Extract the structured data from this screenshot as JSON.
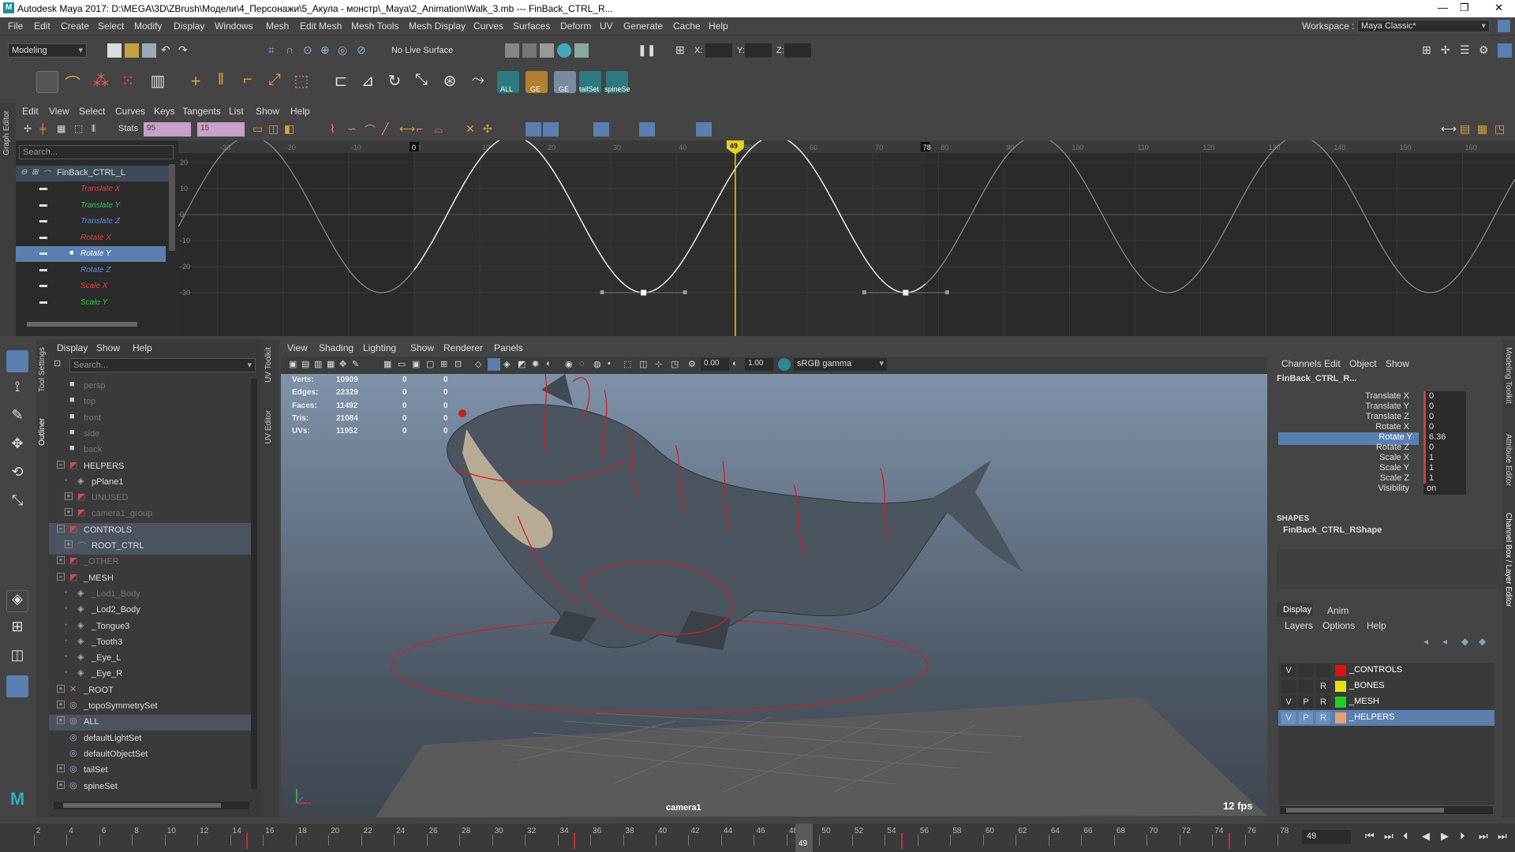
{
  "title": "Autodesk Maya 2017: D:\\MEGA\\3D\\ZBrush\\Модели\\4_Персонажи\\5_Акула - монстр\\_Maya\\2_Animation\\Walk_3.mb  ---  FinBack_CTRL_R...",
  "menubar": [
    "File",
    "Edit",
    "Create",
    "Select",
    "Modify",
    "Display",
    "Windows",
    "Mesh",
    "Edit Mesh",
    "Mesh Tools",
    "Mesh Display",
    "Curves",
    "Surfaces",
    "Deform",
    "UV",
    "Generate",
    "Cache",
    "Help"
  ],
  "workspace_label": "Workspace :",
  "workspace_value": "Maya Classic*",
  "mode_select": "Modeling",
  "live_surface": "No Live Surface",
  "coord_labels": {
    "x": "X:",
    "y": "Y:",
    "z": "Z:"
  },
  "shelf_labels": [
    "ALL",
    "GE",
    "GE",
    "tailSet",
    "spineSe"
  ],
  "graph_editor": {
    "tab": "Graph Editor",
    "menu": [
      "Edit",
      "View",
      "Select",
      "Curves",
      "Keys",
      "Tangents",
      "List",
      "Show",
      "Help"
    ],
    "stats_label": "Stats",
    "stats_values": [
      "95",
      "15"
    ],
    "search_placeholder": "Search...",
    "node": "FinBack_CTRL_L",
    "channels": [
      {
        "name": "Translate X",
        "color": "#e04040"
      },
      {
        "name": "Translate Y",
        "color": "#3cc040"
      },
      {
        "name": "Translate Z",
        "color": "#5a8ae0"
      },
      {
        "name": "Rotate X",
        "color": "#e04040"
      },
      {
        "name": "Rotate Y",
        "color": "#ffffff",
        "selected": true
      },
      {
        "name": "Rotate Z",
        "color": "#5a8ae0"
      },
      {
        "name": "Scale X",
        "color": "#e04040"
      },
      {
        "name": "Scale Y",
        "color": "#3cc040"
      }
    ],
    "x_ticks": [
      "-30",
      "-20",
      "-10",
      "0",
      "10",
      "20",
      "30",
      "40",
      "50",
      "60",
      "70",
      "80",
      "90",
      "100",
      "110",
      "120",
      "130",
      "140",
      "150",
      "160"
    ],
    "y_ticks": [
      "20",
      "10",
      "0",
      "-10",
      "-20",
      "-30"
    ],
    "range_start": "0",
    "range_end": "78",
    "current_frame": "49",
    "curve_data": {
      "type": "line",
      "period_frames": 40,
      "amplitude": 30,
      "frame_range": [
        -36,
        168
      ],
      "keys": [
        {
          "frame": 15,
          "value": 30
        },
        {
          "frame": 35,
          "value": -30
        },
        {
          "frame": 55,
          "value": 30
        },
        {
          "frame": 75,
          "value": -30
        },
        {
          "frame": 95,
          "value": 30
        }
      ]
    }
  },
  "left_tabs": [
    "Tool Settings",
    "Outliner"
  ],
  "outliner": {
    "menu": [
      "Display",
      "Show",
      "Help"
    ],
    "search_placeholder": "Search...",
    "items": [
      {
        "label": "persp",
        "indent": 0,
        "dim": true,
        "type": "camera"
      },
      {
        "label": "top",
        "indent": 0,
        "dim": true,
        "type": "camera"
      },
      {
        "label": "front",
        "indent": 0,
        "dim": true,
        "type": "camera"
      },
      {
        "label": "side",
        "indent": 0,
        "dim": true,
        "type": "camera"
      },
      {
        "label": "back",
        "indent": 0,
        "dim": true,
        "type": "camera"
      },
      {
        "label": "HELPERS",
        "indent": 0,
        "dim": false,
        "type": "group",
        "expander": "−"
      },
      {
        "label": "pPlane1",
        "indent": 1,
        "dim": false,
        "type": "mesh"
      },
      {
        "label": "UNUSED",
        "indent": 1,
        "dim": true,
        "type": "group",
        "expander": "+"
      },
      {
        "label": "camera1_group",
        "indent": 1,
        "dim": true,
        "type": "group",
        "expander": "+"
      },
      {
        "label": "CONTROLS",
        "indent": 0,
        "dim": false,
        "type": "group",
        "expander": "−",
        "highlight": true
      },
      {
        "label": "ROOT_CTRL",
        "indent": 1,
        "dim": false,
        "type": "curve",
        "expander": "+",
        "highlight": true
      },
      {
        "label": "_OTHER",
        "indent": 0,
        "dim": true,
        "type": "group",
        "expander": "+"
      },
      {
        "label": "_MESH",
        "indent": 0,
        "dim": false,
        "type": "group",
        "expander": "−"
      },
      {
        "label": "_Lod1_Body",
        "indent": 1,
        "dim": true,
        "type": "mesh"
      },
      {
        "label": "_Lod2_Body",
        "indent": 1,
        "dim": false,
        "type": "mesh"
      },
      {
        "label": "_Tongue3",
        "indent": 1,
        "dim": false,
        "type": "mesh"
      },
      {
        "label": "_Tooth3",
        "indent": 1,
        "dim": false,
        "type": "mesh"
      },
      {
        "label": "_Eye_L",
        "indent": 1,
        "dim": false,
        "type": "mesh"
      },
      {
        "label": "_Eye_R",
        "indent": 1,
        "dim": false,
        "type": "mesh"
      },
      {
        "label": "_ROOT",
        "indent": 0,
        "dim": false,
        "type": "joint",
        "expander": "+"
      },
      {
        "label": "_topoSymmetrySet",
        "indent": 0,
        "dim": false,
        "type": "set",
        "expander": "+"
      },
      {
        "label": "ALL",
        "indent": 0,
        "dim": false,
        "type": "set",
        "expander": "+",
        "highlight": true
      },
      {
        "label": "defaultLightSet",
        "indent": 0,
        "dim": false,
        "type": "set"
      },
      {
        "label": "defaultObjectSet",
        "indent": 0,
        "dim": false,
        "type": "set"
      },
      {
        "label": "tailSet",
        "indent": 0,
        "dim": false,
        "type": "set",
        "expander": "+"
      },
      {
        "label": "spineSet",
        "indent": 0,
        "dim": false,
        "type": "set",
        "expander": "+"
      }
    ]
  },
  "uv_tabs": [
    "UV Toolkit",
    "UV Editor"
  ],
  "viewport": {
    "menu": [
      "View",
      "Shading",
      "Lighting",
      "Show",
      "Renderer",
      "Panels"
    ],
    "field1": "0.00",
    "field2": "1.00",
    "color_space": "sRGB gamma",
    "camera": "camera1",
    "fps": "12 fps",
    "hud": [
      {
        "label": "Verts:",
        "a": "10909",
        "b": "0",
        "c": "0"
      },
      {
        "label": "Edges:",
        "a": "22329",
        "b": "0",
        "c": "0"
      },
      {
        "label": "Faces:",
        "a": "11492",
        "b": "0",
        "c": "0"
      },
      {
        "label": "Tris:",
        "a": "21084",
        "b": "0",
        "c": "0"
      },
      {
        "label": "UVs:",
        "a": "11952",
        "b": "0",
        "c": "0"
      }
    ]
  },
  "channel_box": {
    "menu": [
      "Channels",
      "Edit",
      "Object",
      "Show"
    ],
    "object": "FinBack_CTRL_R...",
    "attrs": [
      {
        "name": "Translate X",
        "value": "0"
      },
      {
        "name": "Translate Y",
        "value": "0"
      },
      {
        "name": "Translate Z",
        "value": "0"
      },
      {
        "name": "Rotate X",
        "value": "0"
      },
      {
        "name": "Rotate Y",
        "value": "6.36",
        "selected": true
      },
      {
        "name": "Rotate Z",
        "value": "0"
      },
      {
        "name": "Scale X",
        "value": "1"
      },
      {
        "name": "Scale Y",
        "value": "1"
      },
      {
        "name": "Scale Z",
        "value": "1"
      },
      {
        "name": "Visibility",
        "value": "on"
      }
    ],
    "shapes_label": "SHAPES",
    "shape": "FinBack_CTRL_RShape"
  },
  "right_tabs": [
    "Modeling Toolkit",
    "Attribute Editor",
    "Channel Box / Layer Editor"
  ],
  "layer_editor": {
    "tabs": [
      "Display",
      "Anim"
    ],
    "menu": [
      "Layers",
      "Options",
      "Help"
    ],
    "layers": [
      {
        "v": "V",
        "p": "",
        "r": "",
        "color": "#e01010",
        "name": "_CONTROLS"
      },
      {
        "v": "",
        "p": "",
        "r": "R",
        "color": "#e8e010",
        "name": "_BONES"
      },
      {
        "v": "V",
        "p": "P",
        "r": "R",
        "color": "#20d020",
        "name": "_MESH"
      },
      {
        "v": "V",
        "p": "P",
        "r": "R",
        "color": "#e8a070",
        "name": "_HELPERS",
        "selected": true
      }
    ]
  },
  "timeslider": {
    "ticks": [
      "2",
      "4",
      "6",
      "8",
      "10",
      "12",
      "14",
      "16",
      "18",
      "20",
      "22",
      "24",
      "26",
      "28",
      "30",
      "32",
      "34",
      "36",
      "38",
      "40",
      "42",
      "44",
      "46",
      "48",
      "50",
      "52",
      "54",
      "56",
      "58",
      "60",
      "62",
      "64",
      "66",
      "68",
      "70",
      "72",
      "74",
      "76",
      "78"
    ],
    "current": "49",
    "current_field": "49"
  }
}
